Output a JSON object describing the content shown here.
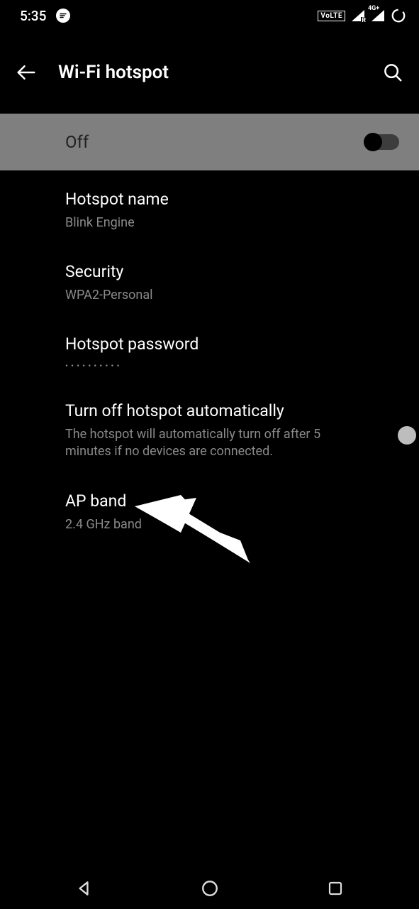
{
  "statusbar": {
    "time": "5:35",
    "volte_label": "VoLTE",
    "signal1_sub": "R",
    "signal2_sub": "4G+"
  },
  "appbar": {
    "title": "Wi-Fi hotspot"
  },
  "master": {
    "label": "Off",
    "enabled": false
  },
  "items": {
    "hotspot_name": {
      "title": "Hotspot name",
      "value": "Blink Engine"
    },
    "security": {
      "title": "Security",
      "value": "WPA2-Personal"
    },
    "password": {
      "title": "Hotspot password",
      "value": "••••••••••"
    },
    "auto_off": {
      "title": "Turn off hotspot automatically",
      "desc": "The hotspot will automatically turn off after 5 minutes if no devices are connected.",
      "enabled": false
    },
    "ap_band": {
      "title": "AP band",
      "value": "2.4 GHz band"
    }
  }
}
